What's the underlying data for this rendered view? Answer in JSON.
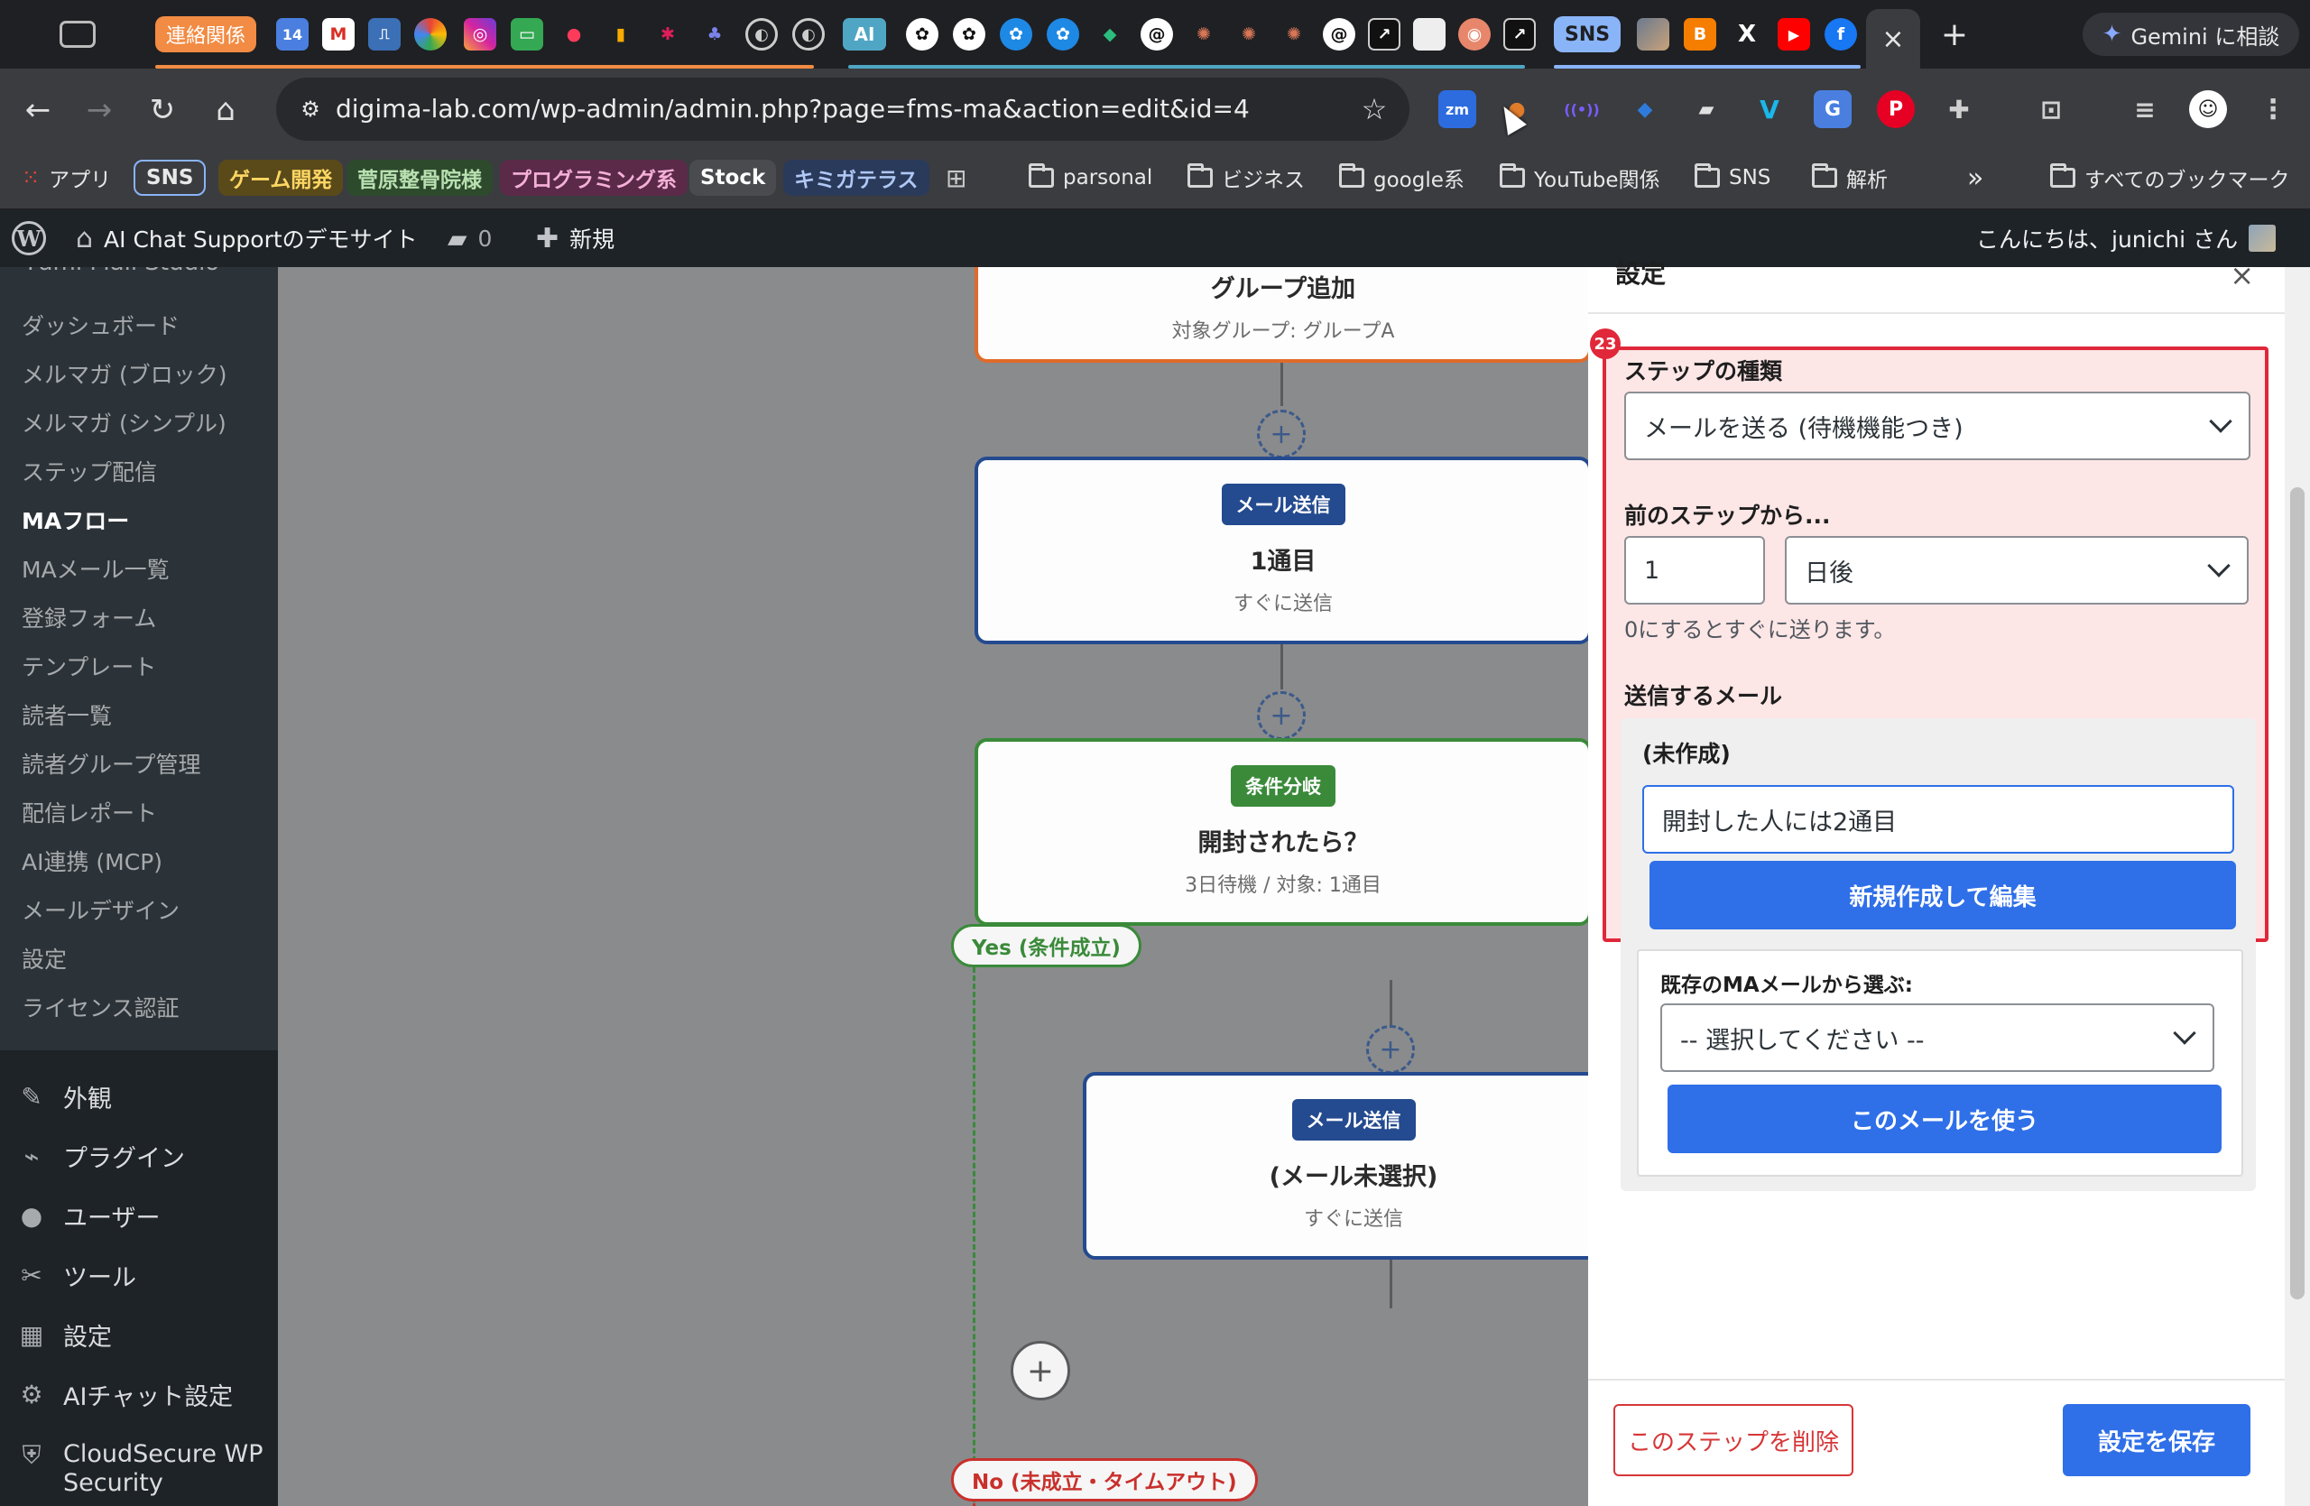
{
  "browser": {
    "tab_group_renraku": "連絡関係",
    "tab_group_sns": "SNS",
    "tab_calendar_day": "14",
    "tab_ai_label": "AI",
    "tabs": [
      {
        "icon": "screen-icon"
      },
      {
        "icon": "calendar-icon"
      },
      {
        "icon": "gmail-icon"
      },
      {
        "icon": "notebook-icon"
      },
      {
        "icon": "photos-icon"
      },
      {
        "icon": "instagram-icon"
      },
      {
        "icon": "chat-icon"
      },
      {
        "icon": "dots-icon"
      },
      {
        "icon": "analytics-icon"
      },
      {
        "icon": "slack-icon"
      },
      {
        "icon": "teams-icon"
      },
      {
        "icon": "globe-icon"
      },
      {
        "icon": "globe-icon"
      },
      {
        "icon": "ai-icon"
      },
      {
        "icon": "openai-icon"
      },
      {
        "icon": "openai-icon"
      },
      {
        "icon": "openai-icon"
      },
      {
        "icon": "openai-icon"
      },
      {
        "icon": "perplexity-icon"
      },
      {
        "icon": "threads-icon"
      },
      {
        "icon": "claude-icon"
      },
      {
        "icon": "claude-icon"
      },
      {
        "icon": "claude-icon"
      },
      {
        "icon": "threads-icon"
      },
      {
        "icon": "external-icon"
      },
      {
        "icon": "page-icon"
      },
      {
        "icon": "orange-icon"
      },
      {
        "icon": "external-icon"
      }
    ],
    "sns_tabs": [
      {
        "icon": "photo-icon"
      },
      {
        "icon": "blogger-icon"
      },
      {
        "icon": "x-icon"
      },
      {
        "icon": "youtube-icon"
      },
      {
        "icon": "facebook-icon"
      }
    ],
    "active_tab_close": "×",
    "new_tab": "+",
    "gemini_button": "Gemini に相談",
    "url": "digima-lab.com/wp-admin/admin.php?page=fms-ma&action=edit&id=4",
    "extensions": [
      {
        "name": "zoom-icon",
        "label": "zm",
        "color": "#2d6cdf"
      },
      {
        "name": "rocket-icon",
        "label": "●",
        "color": "#e07b2a"
      },
      {
        "name": "broadcast-icon",
        "label": "((•))",
        "color": "#7a5cff"
      },
      {
        "name": "tag-icon",
        "label": "◆",
        "color": "#2f7bdc"
      },
      {
        "name": "eraser-icon",
        "label": "▰",
        "color": "#e0e0e0"
      },
      {
        "name": "v-icon",
        "label": "V",
        "color": "#1ab7ea"
      },
      {
        "name": "translate-icon",
        "label": "G",
        "color": "#4a7fe0"
      },
      {
        "name": "pinterest-icon",
        "label": "P",
        "color": "#e60023"
      },
      {
        "name": "puzzle-icon",
        "label": "⚙",
        "color": "#d0d0d0"
      },
      {
        "name": "search-tab-icon",
        "label": "⊡",
        "color": "#d0d0d0"
      },
      {
        "name": "media-icon",
        "label": "≡",
        "color": "#d0d0d0"
      }
    ],
    "bookmarks": {
      "apps": "アプリ",
      "sns": "SNS",
      "game": "ゲーム開発",
      "sugawara": "菅原整骨院様",
      "programming": "プログラミング系",
      "stock": "Stock",
      "kimigaterasu": "キミガテラス",
      "parsonal": "parsonal",
      "business": "ビジネス",
      "google": "google系",
      "youtube": "YouTube関係",
      "sns_folder": "SNS",
      "analysis": "解析",
      "more": "»",
      "all": "すべてのブックマーク"
    }
  },
  "adminbar": {
    "site_name": "AI Chat Supportのデモサイト",
    "comments": "0",
    "new": "新規",
    "greeting": "こんにちは、junichi さん"
  },
  "sidebar": {
    "plugin_title": "Fami Mail Studio",
    "submenu": [
      "ダッシュボード",
      "メルマガ (ブロック)",
      "メルマガ (シンプル)",
      "ステップ配信",
      "MAフロー",
      "MAメール一覧",
      "登録フォーム",
      "テンプレート",
      "読者一覧",
      "読者グループ管理",
      "配信レポート",
      "AI連携 (MCP)",
      "メールデザイン",
      "設定",
      "ライセンス認証"
    ],
    "menu": [
      {
        "label": "外観",
        "icon": "brush-icon"
      },
      {
        "label": "プラグイン",
        "icon": "plugin-icon"
      },
      {
        "label": "ユーザー",
        "icon": "user-icon"
      },
      {
        "label": "ツール",
        "icon": "wrench-icon"
      },
      {
        "label": "設定",
        "icon": "settings-icon"
      },
      {
        "label": "AIチャット設定",
        "icon": "gear-icon"
      },
      {
        "label": "CloudSecure WP Security",
        "icon": "shield-icon"
      }
    ]
  },
  "flow": {
    "group_node": {
      "title": "グループ追加",
      "sub": "対象グループ: グループA"
    },
    "mail1": {
      "badge": "メール送信",
      "title": "1通目",
      "sub": "すぐに送信"
    },
    "cond": {
      "badge": "条件分岐",
      "title": "開封されたら？",
      "sub": "3日待機 / 対象: 1通目"
    },
    "yes_label": "Yes (条件成立)",
    "mail2": {
      "badge": "メール送信",
      "title": "(メール未選択)",
      "sub": "すぐに送信"
    },
    "no_label": "No (未成立・タイムアウト)",
    "add_symbol": "+",
    "colors": {
      "mail": "#244a8f",
      "cond": "#3a8a3a",
      "group": "#e06a2a",
      "no": "#c9302c"
    }
  },
  "panel": {
    "title": "設定",
    "close": "×",
    "highlight_number": "23",
    "step_type_label": "ステップの種類",
    "step_type_value": "メールを送る (待機機能つき)",
    "from_prev_label": "前のステップから...",
    "wait_value": "1",
    "wait_unit": "日後",
    "wait_hint": "0にするとすぐに送ります。",
    "send_mail_label": "送信するメール",
    "mail_status": "(未作成)",
    "new_mail_title": "開封した人には2通目",
    "create_button": "新規作成して編集",
    "existing_label": "既存のMAメールから選ぶ:",
    "existing_select": "-- 選択してください --",
    "use_button": "このメールを使う",
    "delete_button": "このステップを削除",
    "save_button": "設定を保存"
  }
}
